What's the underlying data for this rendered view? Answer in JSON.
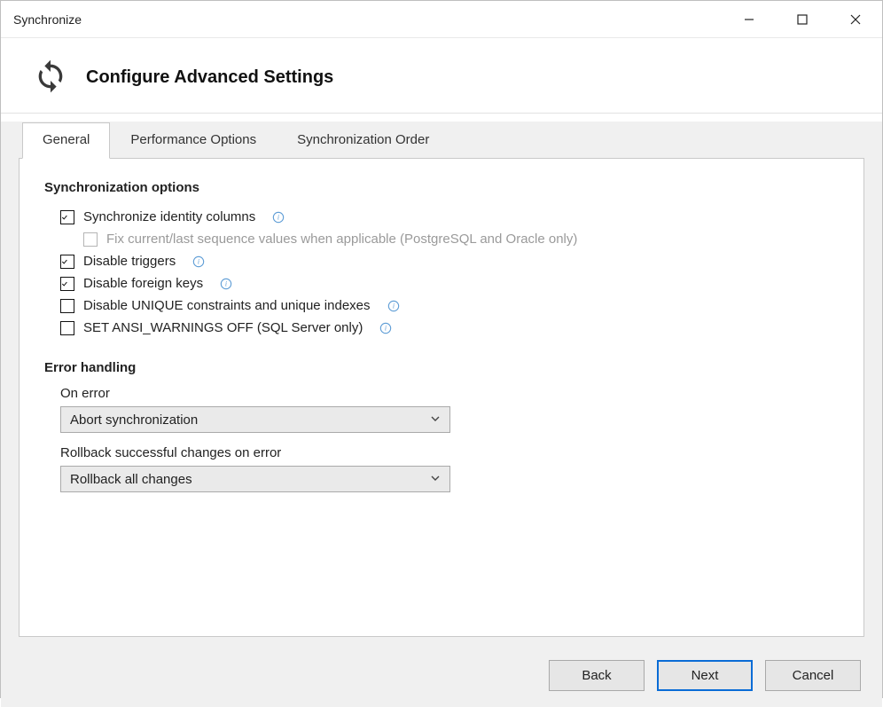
{
  "window": {
    "title": "Synchronize"
  },
  "header": {
    "title": "Configure Advanced Settings"
  },
  "tabs": [
    {
      "label": "General",
      "active": true
    },
    {
      "label": "Performance Options",
      "active": false
    },
    {
      "label": "Synchronization Order",
      "active": false
    }
  ],
  "sections": {
    "sync_options": {
      "heading": "Synchronization options",
      "items": {
        "identity": "Synchronize identity columns",
        "fix_sequence": "Fix current/last sequence values when applicable (PostgreSQL and Oracle only)",
        "disable_triggers": "Disable triggers",
        "disable_fk": "Disable foreign keys",
        "disable_unique": "Disable UNIQUE constraints and unique indexes",
        "ansi_warnings": "SET ANSI_WARNINGS OFF (SQL Server only)"
      }
    },
    "error_handling": {
      "heading": "Error handling",
      "on_error_label": "On error",
      "on_error_value": "Abort synchronization",
      "rollback_label": "Rollback successful changes on error",
      "rollback_value": "Rollback all changes"
    }
  },
  "footer": {
    "back": "Back",
    "next": "Next",
    "cancel": "Cancel"
  }
}
